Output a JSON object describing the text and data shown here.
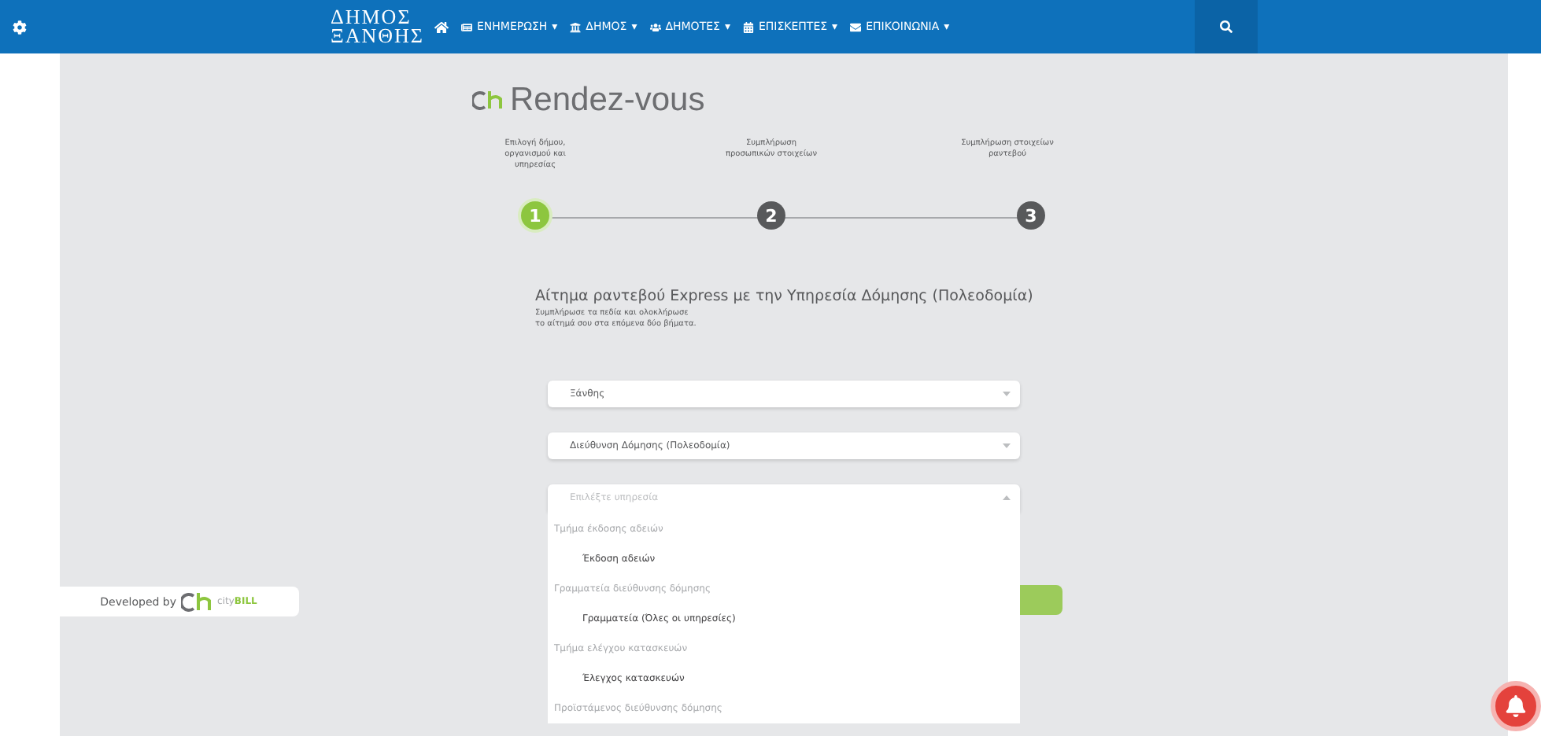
{
  "header": {
    "logo": [
      "ΔΗΜΟΣ",
      "ΞΑΝΘΗΣ"
    ],
    "menu": [
      {
        "label": "ΕΝΗΜΕΡΩΣΗ",
        "caret": "▾"
      },
      {
        "label": "ΔΗΜΟΣ",
        "caret": "▾"
      },
      {
        "label": "ΔΗΜΟΤΕΣ",
        "caret": "▾"
      },
      {
        "label": "ΕΠΙΣΚΕΠΤΕΣ",
        "caret": "▾"
      },
      {
        "label": "ΕΠΙΚΟΙΝΩΝΙΑ",
        "caret": "▾"
      }
    ]
  },
  "title": "Rendez-vous",
  "steps": [
    {
      "number": "1",
      "label": "Επιλογή δήμου, οργανισμού και υπηρεσίας",
      "selected": true
    },
    {
      "number": "2",
      "label": "Συμπλήρωση προσωπικών στοιχείων",
      "selected": false
    },
    {
      "number": "3",
      "label": "Συμπλήρωση στοιχείων ραντεβού",
      "selected": false
    }
  ],
  "form": {
    "heading": "Αίτημα ραντεβού Express με την Υπηρεσία Δόμησης (Πολεοδομία)",
    "intro": [
      "Συμπλήρωσε τα πεδία και ολοκλήρωσε",
      "το αίτημά σου στα επόμενα δύο βήματα."
    ],
    "selects": [
      {
        "value": "Ξάνθης",
        "expanded": false
      },
      {
        "value": "Διεύθυνση Δόμησης (Πολεοδομία)",
        "expanded": false
      },
      {
        "placeholder": "Επιλέξτε υπηρεσία",
        "expanded": true
      }
    ],
    "options": [
      {
        "kind": "group",
        "label": "Τμήμα έκδοσης αδειών"
      },
      {
        "kind": "option",
        "label": "Έκδοση αδειών"
      },
      {
        "kind": "group",
        "label": "Γραμματεία διεύθυνσης δόμησης"
      },
      {
        "kind": "option",
        "label": "Γραμματεία (Όλες οι υπηρεσίες)"
      },
      {
        "kind": "group",
        "label": "Τμήμα ελέγχου κατασκευών"
      },
      {
        "kind": "option",
        "label": "Έλεγχος κατασκευών"
      },
      {
        "kind": "group",
        "label": "Προϊστάμενος διεύθυνσης δόμησης"
      }
    ]
  },
  "footer_badge": {
    "label": "Developed by",
    "brand_prefix": "city",
    "brand_suffix": "BILL"
  }
}
